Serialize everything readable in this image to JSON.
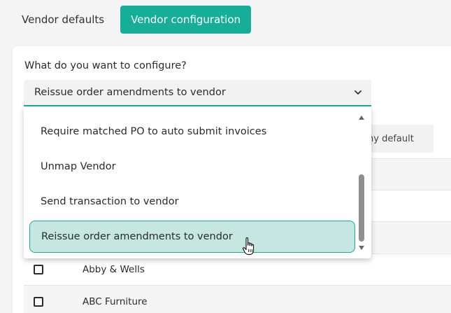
{
  "tabs": [
    {
      "label": "Vendor defaults",
      "active": false
    },
    {
      "label": "Vendor configuration",
      "active": true
    }
  ],
  "config": {
    "question": "What do you want to configure?",
    "selected_value": "Reissue order amendments to vendor",
    "options": [
      "Require matched PO to auto submit invoices",
      "Unmap Vendor",
      "Send transaction to vendor",
      "Reissue order amendments to vendor"
    ],
    "selected_index": 3
  },
  "background_button": {
    "label": "ny default"
  },
  "vendors": [
    {
      "name": "Abby & Wells"
    },
    {
      "name": "ABC Furniture"
    }
  ],
  "colors": {
    "accent": "#16ad99",
    "selected_bg": "#c5e6e1"
  },
  "icons": {
    "select_chevron": "chevron-down-icon",
    "cursor": "hand-pointer-icon"
  }
}
